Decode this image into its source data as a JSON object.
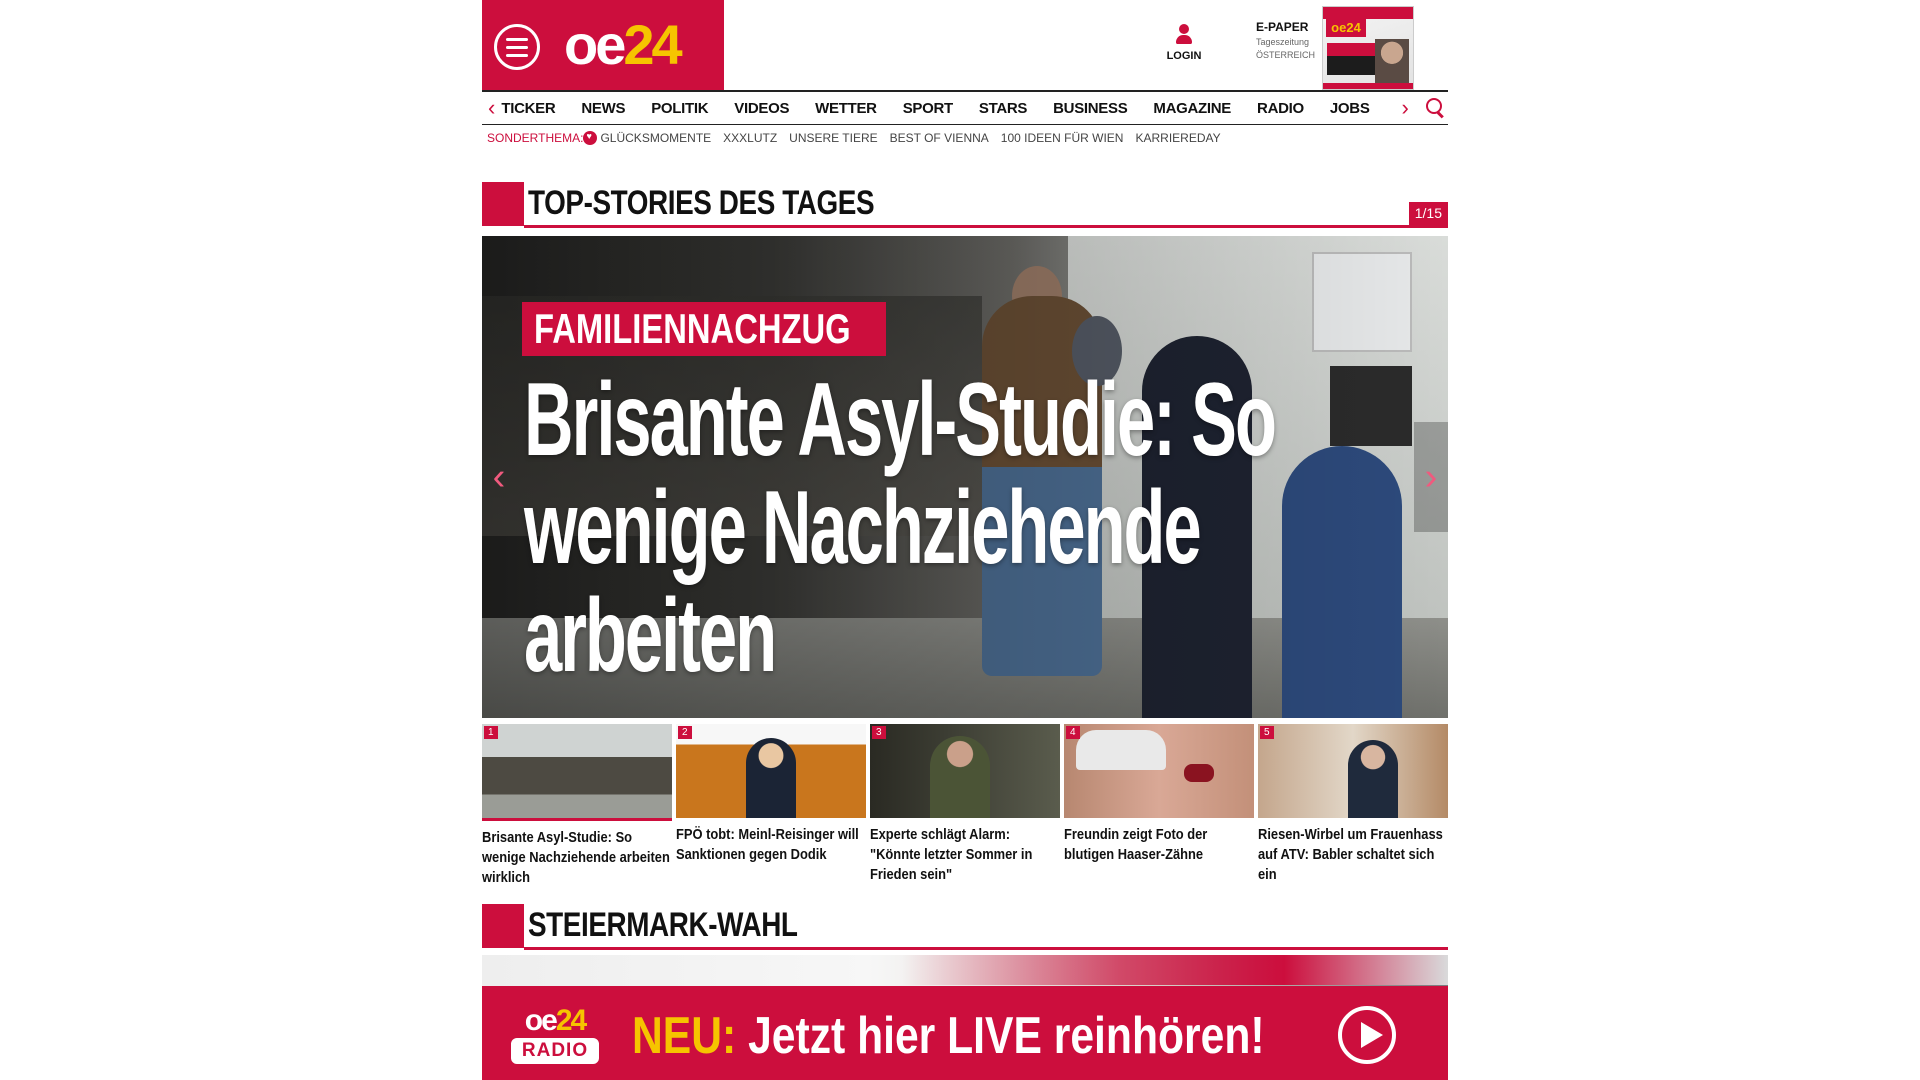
{
  "header": {
    "logo": {
      "oe": "oe",
      "num": "24"
    },
    "login_label": "LOGIN",
    "epaper": {
      "title": "E-PAPER",
      "sub1": "Tageszeitung",
      "sub2": "ÖSTERREICH",
      "cover_logo": "oe24"
    }
  },
  "nav": {
    "items": [
      "TICKER",
      "NEWS",
      "POLITIK",
      "VIDEOS",
      "WETTER",
      "SPORT",
      "STARS",
      "BUSINESS",
      "MAGAZINE",
      "RADIO",
      "JOBS"
    ]
  },
  "subnav": {
    "label": "SONDERTHEMA:",
    "items": [
      "GLÜCKSMOMENTE",
      "XXXLUTZ",
      "UNSERE TIERE",
      "BEST OF VIENNA",
      "100 IDEEN FÜR WIEN",
      "KARRIEREDAY"
    ]
  },
  "top_stories": {
    "title": "TOP-STORIES DES TAGES",
    "counter": "1/15",
    "hero": {
      "kicker": "FAMILIENNACHZUG",
      "headline": "Brisante Asyl-Studie: So wenige Nachziehende arbeiten"
    },
    "thumbs": [
      {
        "num": "1",
        "title": "Brisante Asyl-Studie: So wenige Nachziehende arbeiten wirklich"
      },
      {
        "num": "2",
        "title": "FPÖ tobt: Meinl-Reisinger will Sanktionen gegen Dodik"
      },
      {
        "num": "3",
        "title": "Experte schlägt Alarm: \"Könnte letzter Sommer in Frieden sein\""
      },
      {
        "num": "4",
        "title": "Freundin zeigt Foto der blutigen Haaser-Zähne"
      },
      {
        "num": "5",
        "title": "Riesen-Wirbel um Frauenhass auf ATV: Babler schaltet sich ein"
      }
    ]
  },
  "section2": {
    "title": "STEIERMARK-WAHL"
  },
  "radio_banner": {
    "logo_oe": "oe",
    "logo_num": "24",
    "logo_radio": "RADIO",
    "new_label": "NEU:",
    "text": "Jetzt hier LIVE reinhören!"
  },
  "colors": {
    "brand_red": "#cc0e3d",
    "brand_yellow": "#f6c400"
  }
}
